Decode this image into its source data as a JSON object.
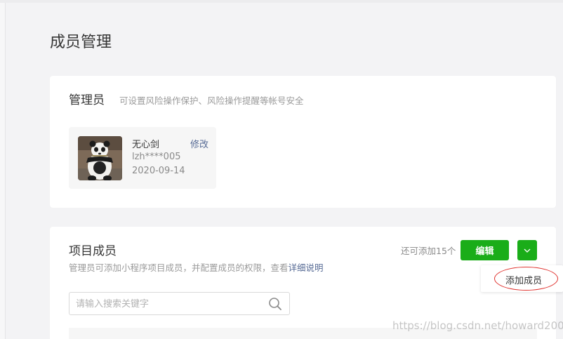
{
  "page": {
    "title": "成员管理"
  },
  "admin": {
    "title": "管理员",
    "description": "可设置风险操作保护、风险操作提醒等帐号安全",
    "name": "无心剑",
    "account": "lzh****005",
    "date": "2020-09-14",
    "edit_label": "修改",
    "avatar_icon": "panda-avatar"
  },
  "members": {
    "title": "项目成员",
    "description": "管理员可添加小程序项目成员，并配置成员的权限，查看",
    "description_link": "详细说明",
    "remaining": "还可添加15个",
    "edit_button": "编辑",
    "dropdown_icon": "chevron-down-icon",
    "search_placeholder": "请输入搜索关键字",
    "search_icon": "search-icon",
    "dropdown_menu": {
      "add_member": "添加成员"
    }
  },
  "watermark": "https://blog.csdn.net/howard2005",
  "colors": {
    "accent": "#1aad19",
    "link": "#576b95",
    "annotation": "#e0322e"
  }
}
